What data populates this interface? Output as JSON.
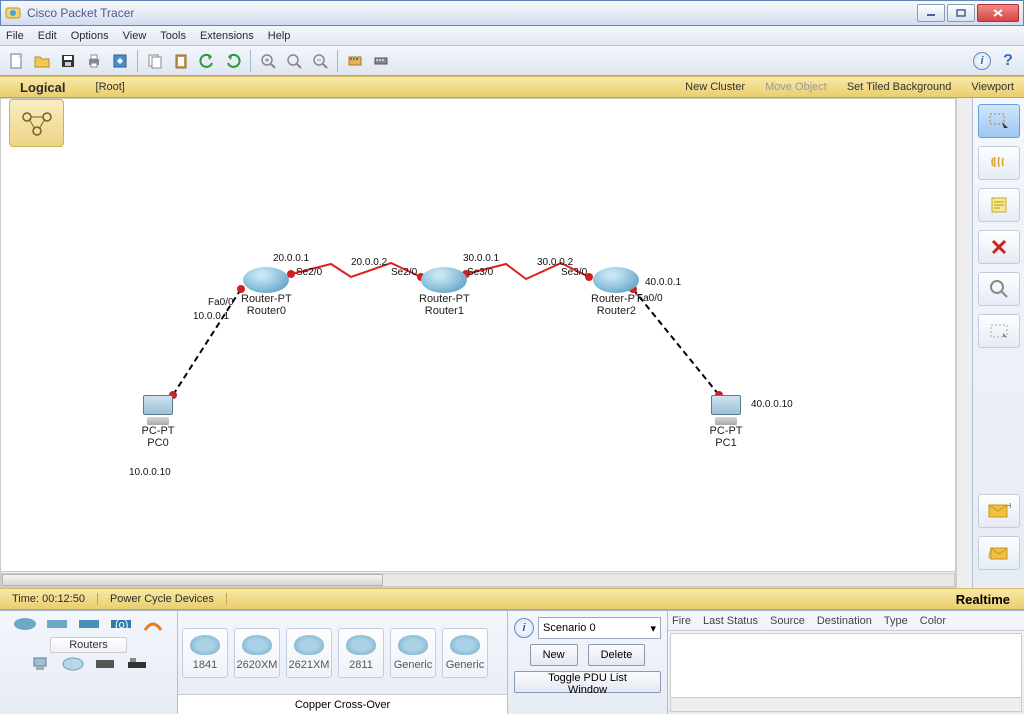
{
  "window": {
    "title": "Cisco Packet Tracer"
  },
  "menu": {
    "file": "File",
    "edit": "Edit",
    "options": "Options",
    "view": "View",
    "tools": "Tools",
    "extensions": "Extensions",
    "help": "Help"
  },
  "topbar": {
    "logical": "Logical",
    "root": "[Root]",
    "new_cluster": "New Cluster",
    "move_object": "Move Object",
    "set_bg": "Set Tiled Background",
    "viewport": "Viewport"
  },
  "timebar": {
    "time": "Time: 00:12:50",
    "power": "Power Cycle Devices",
    "realtime": "Realtime"
  },
  "device_category": {
    "label": "Routers"
  },
  "devices": [
    {
      "label": "1841"
    },
    {
      "label": "2620XM"
    },
    {
      "label": "2621XM"
    },
    {
      "label": "2811"
    },
    {
      "label": "Generic"
    },
    {
      "label": "Generic"
    }
  ],
  "connection_status": "Copper Cross-Over",
  "scenario": {
    "name": "Scenario 0",
    "new": "New",
    "delete": "Delete",
    "toggle": "Toggle PDU List Window"
  },
  "pdu_headers": {
    "fire": "Fire",
    "last": "Last Status",
    "source": "Source",
    "dest": "Destination",
    "type": "Type",
    "color": "Color"
  },
  "nodes": {
    "pc0": {
      "type": "PC-PT",
      "name": "PC0",
      "ip": "10.0.0.10"
    },
    "pc1": {
      "type": "PC-PT",
      "name": "PC1",
      "ip": "40.0.0.10"
    },
    "r0": {
      "type": "Router-PT",
      "name": "Router0"
    },
    "r1": {
      "type": "Router-PT",
      "name": "Router1"
    },
    "r2": {
      "type": "Router-PT",
      "name": "Router2"
    }
  },
  "interfaces": {
    "r0_fa00": "Fa0/0",
    "r0_fa00_ip": "10.0.0.1",
    "r0_se20": "Se2/0",
    "r0_se20_ip": "20.0.0.1",
    "r1_se20": "Se2/0",
    "r1_se20_ip": "20.0.0.2",
    "r1_se30": "Se3/0",
    "r1_se30_ip": "30.0.0.1",
    "r2_se30": "Se3/0",
    "r2_se30_ip": "30.0.0.2",
    "r2_fa00": "Fa0/0",
    "r2_fa00_ip": "40.0.0.1"
  }
}
